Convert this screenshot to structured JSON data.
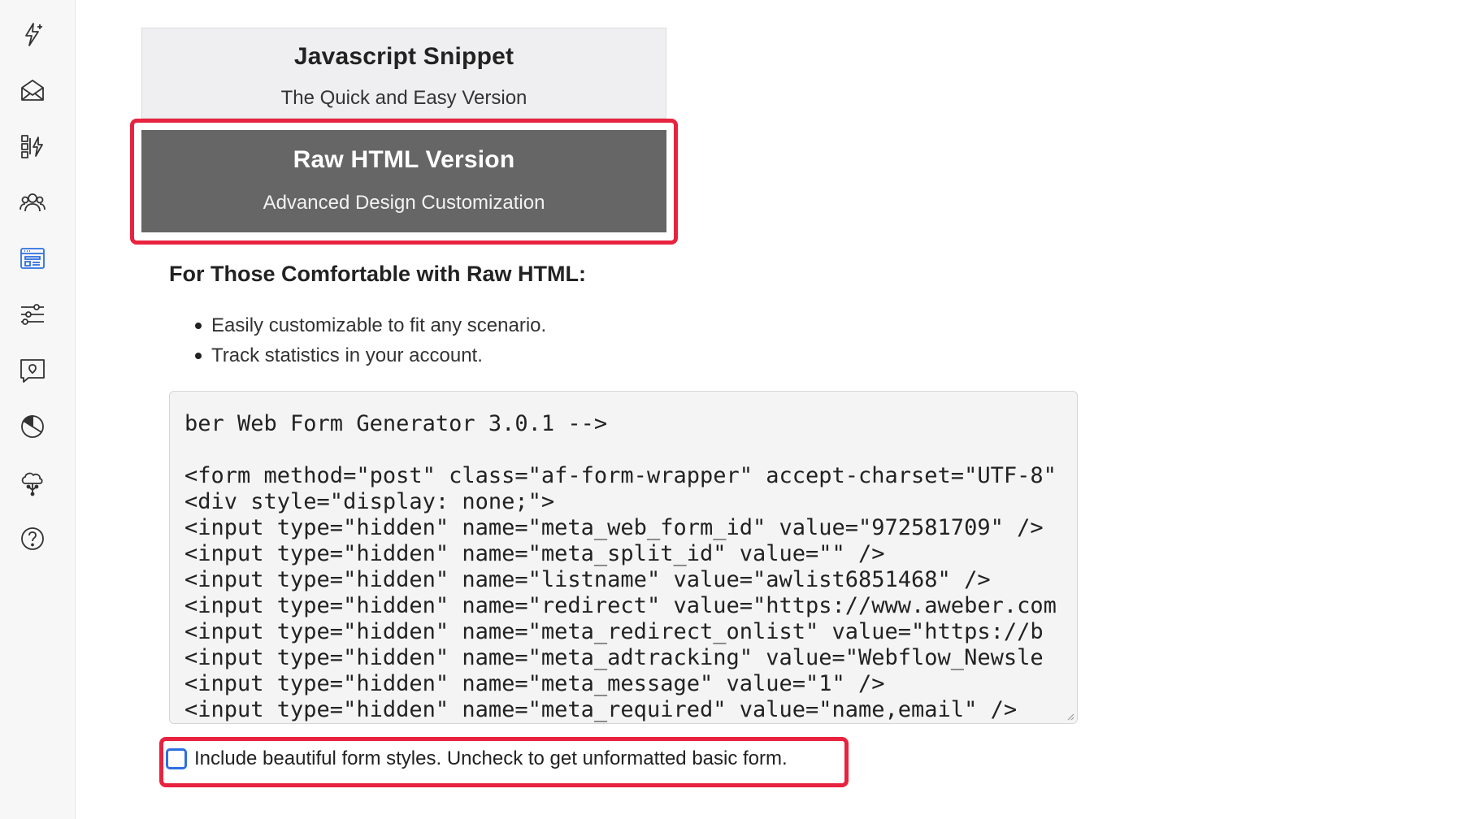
{
  "sidebar": {
    "items": [
      {
        "icon": "lightning-sparkle-icon"
      },
      {
        "icon": "envelope-icon"
      },
      {
        "icon": "automation-icon"
      },
      {
        "icon": "subscribers-icon"
      },
      {
        "icon": "signup-form-icon",
        "active": true
      },
      {
        "icon": "sliders-icon"
      },
      {
        "icon": "landing-page-icon"
      },
      {
        "icon": "reports-pie-icon"
      },
      {
        "icon": "integrations-cloud-icon"
      },
      {
        "icon": "help-icon"
      }
    ]
  },
  "tabs": {
    "js": {
      "title": "Javascript Snippet",
      "subtitle": "The Quick and Easy Version"
    },
    "raw": {
      "title": "Raw HTML Version",
      "subtitle": "Advanced Design Customization"
    }
  },
  "section": {
    "heading": "For Those Comfortable with Raw HTML:",
    "features": [
      "Easily customizable to fit any scenario.",
      "Track statistics in your account."
    ]
  },
  "code": {
    "lines": [
      "ber Web Form Generator 3.0.1 -->",
      "",
      "<form method=\"post\" class=\"af-form-wrapper\" accept-charset=\"UTF-8\"",
      "<div style=\"display: none;\">",
      "<input type=\"hidden\" name=\"meta_web_form_id\" value=\"972581709\" />",
      "<input type=\"hidden\" name=\"meta_split_id\" value=\"\" />",
      "<input type=\"hidden\" name=\"listname\" value=\"awlist6851468\" />",
      "<input type=\"hidden\" name=\"redirect\" value=\"https://www.aweber.com",
      "<input type=\"hidden\" name=\"meta_redirect_onlist\" value=\"https://b",
      "<input type=\"hidden\" name=\"meta_adtracking\" value=\"Webflow_Newsle",
      "<input type=\"hidden\" name=\"meta_message\" value=\"1\" />",
      "<input type=\"hidden\" name=\"meta_required\" value=\"name,email\" />"
    ]
  },
  "styles_option": {
    "label": "Include beautiful form styles. Uncheck to get unformatted basic form.",
    "checked": false
  },
  "colors": {
    "highlight": "#e8233f",
    "active_tab": "#666666",
    "checkbox_border": "#2f6fe0"
  }
}
